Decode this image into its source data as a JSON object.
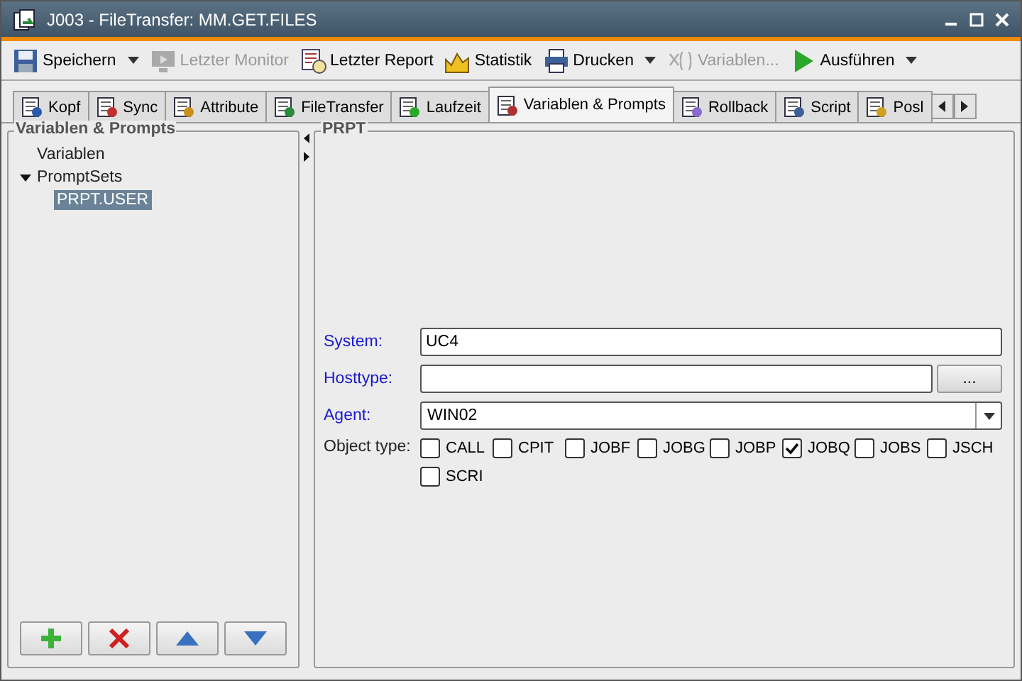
{
  "window": {
    "title": "J003 - FileTransfer: MM.GET.FILES"
  },
  "toolbar": [
    {
      "label": "Speichern",
      "disabled": false,
      "menu": true
    },
    {
      "label": "Letzter Monitor",
      "disabled": true,
      "menu": false
    },
    {
      "label": "Letzter Report",
      "disabled": false,
      "menu": false
    },
    {
      "label": "Statistik",
      "disabled": false,
      "menu": false
    },
    {
      "label": "Drucken",
      "disabled": false,
      "menu": true
    },
    {
      "label": "Variablen...",
      "disabled": true,
      "menu": false
    },
    {
      "label": "Ausführen",
      "disabled": false,
      "menu": true
    }
  ],
  "tabs": [
    {
      "label": "Kopf",
      "selected": false
    },
    {
      "label": "Sync",
      "selected": false
    },
    {
      "label": "Attribute",
      "selected": false
    },
    {
      "label": "FileTransfer",
      "selected": false
    },
    {
      "label": "Laufzeit",
      "selected": false
    },
    {
      "label": "Variablen & Prompts",
      "selected": true
    },
    {
      "label": "Rollback",
      "selected": false
    },
    {
      "label": "Script",
      "selected": false
    },
    {
      "label": "Posl",
      "selected": false
    }
  ],
  "left_panel": {
    "title": "Variablen & Prompts",
    "tree": [
      {
        "label": "Variablen",
        "selected": false
      },
      {
        "label": "PromptSets",
        "selected": false,
        "expanded": true,
        "children": [
          {
            "label": "PRPT.USER",
            "selected": true
          }
        ]
      }
    ]
  },
  "right_panel": {
    "title": "PRPT",
    "fields": [
      {
        "kind": "text",
        "label": "System:",
        "value": "UC4"
      },
      {
        "kind": "browse",
        "label": "Hosttype:",
        "button": "..."
      },
      {
        "kind": "select",
        "label": "Agent:",
        "value": "WIN02"
      }
    ],
    "object_type": {
      "label": "Object type:",
      "options": [
        {
          "label": "CALL",
          "checked": false
        },
        {
          "label": "CPIT",
          "checked": false
        },
        {
          "label": "JOBF",
          "checked": false
        },
        {
          "label": "JOBG",
          "checked": false
        },
        {
          "label": "JOBP",
          "checked": false
        },
        {
          "label": "JOBQ",
          "checked": true
        },
        {
          "label": "JOBS",
          "checked": false
        },
        {
          "label": "JSCH",
          "checked": false
        },
        {
          "label": "SCRI",
          "checked": false
        }
      ]
    }
  }
}
